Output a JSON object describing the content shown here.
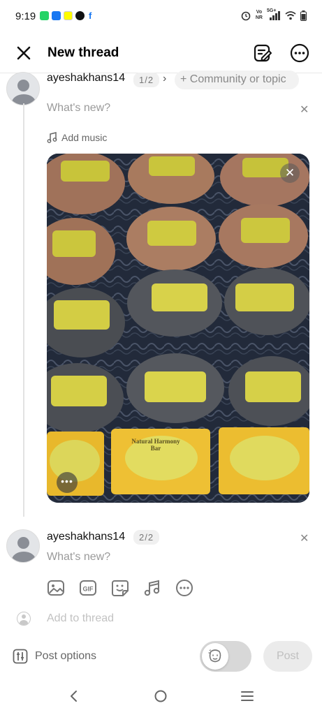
{
  "status_bar": {
    "time": "9:19",
    "network_label_top": "Vo",
    "network_label_bottom": "NR",
    "signal_label": "5G+"
  },
  "header": {
    "title": "New thread"
  },
  "post1": {
    "username": "ayeshakhans14",
    "counter": "1/2",
    "topic_placeholder": "+ Community or topic",
    "text_placeholder": "What's new?",
    "add_music_label": "Add music",
    "image_label": "Natural Harmony Bar"
  },
  "post2": {
    "username": "ayeshakhans14",
    "counter": "2/2",
    "text_placeholder": "What's new?"
  },
  "add_thread": {
    "placeholder": "Add to thread"
  },
  "footer": {
    "post_options_label": "Post options",
    "post_button_label": "Post"
  },
  "colors": {
    "accent_disabled": "#ebebeb",
    "muted_text": "#9a9a9a"
  }
}
